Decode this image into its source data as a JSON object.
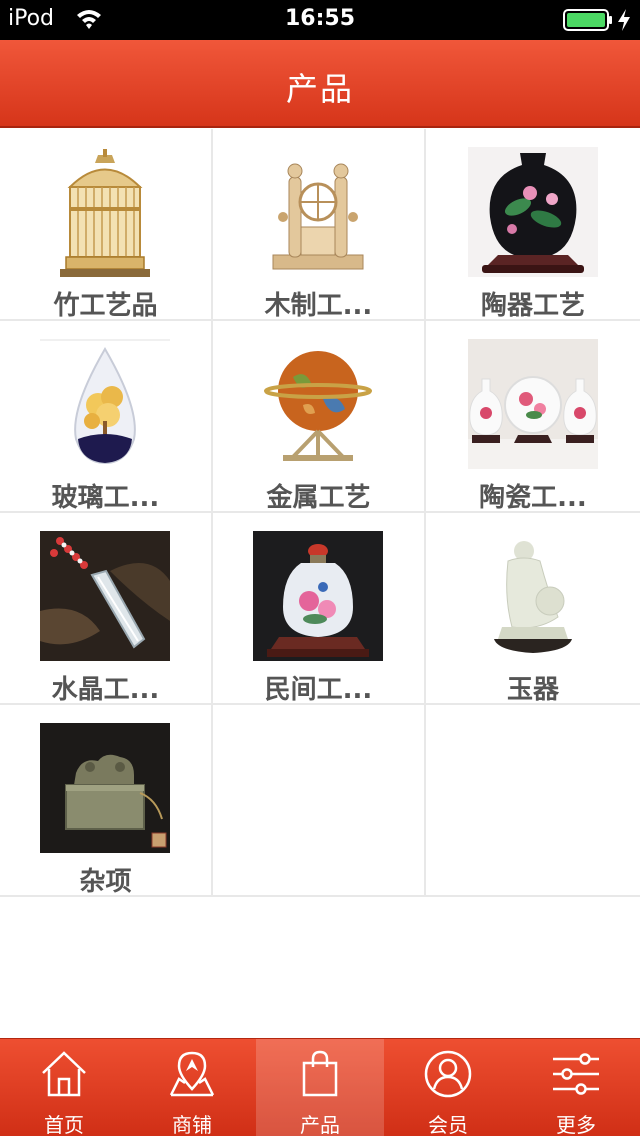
{
  "status_bar": {
    "carrier": "iPod",
    "time": "16:55"
  },
  "header": {
    "title": "产品"
  },
  "products": [
    {
      "label": "竹工艺品",
      "icon": "bamboo-birdcage-image"
    },
    {
      "label": "木制工...",
      "icon": "wooden-craft-image"
    },
    {
      "label": "陶器工艺",
      "icon": "pottery-vase-image"
    },
    {
      "label": "玻璃工...",
      "icon": "glass-crystal-tree-image"
    },
    {
      "label": "金属工艺",
      "icon": "metal-globe-image"
    },
    {
      "label": "陶瓷工...",
      "icon": "porcelain-set-image"
    },
    {
      "label": "水晶工...",
      "icon": "crystal-pendant-image"
    },
    {
      "label": "民间工...",
      "icon": "snuff-bottle-image"
    },
    {
      "label": "玉器",
      "icon": "jade-figure-image"
    },
    {
      "label": "杂项",
      "icon": "seal-stamp-image"
    }
  ],
  "tab_bar": {
    "tabs": [
      {
        "label": "首页",
        "icon": "home-icon"
      },
      {
        "label": "商铺",
        "icon": "map-pin-icon"
      },
      {
        "label": "产品",
        "icon": "shopping-bag-icon",
        "active": true
      },
      {
        "label": "会员",
        "icon": "user-icon"
      },
      {
        "label": "更多",
        "icon": "sliders-icon"
      }
    ]
  },
  "colors": {
    "header_red": "#e4442a",
    "label_gray": "#555555",
    "battery_green": "#4cd964"
  }
}
